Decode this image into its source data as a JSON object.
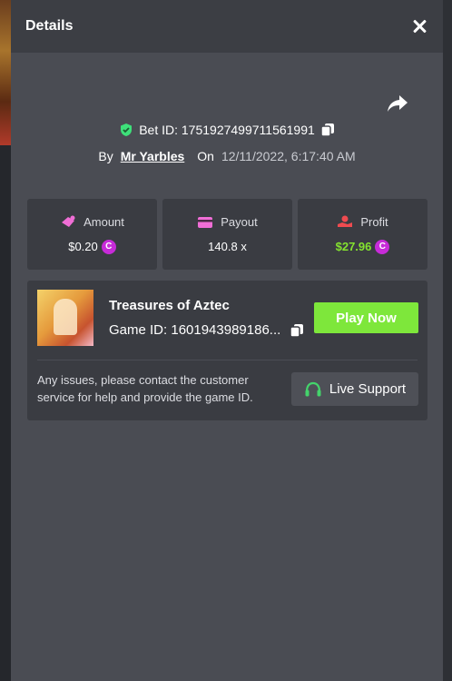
{
  "header": {
    "title": "Details"
  },
  "bet": {
    "label": "Bet ID: 1751927499711561991",
    "by_label": "By",
    "user": "Mr Yarbles",
    "on_label": "On",
    "datetime": "12/11/2022, 6:17:40 AM"
  },
  "stats": {
    "amount": {
      "label": "Amount",
      "value": "$0.20"
    },
    "payout": {
      "label": "Payout",
      "value": "140.8 x"
    },
    "profit": {
      "label": "Profit",
      "value": "$27.96"
    }
  },
  "game": {
    "name": "Treasures of Aztec",
    "id_text": "Game ID: 1601943989186...",
    "play_label": "Play Now",
    "help_text": "Any issues, please contact the customer service for help and provide the game ID.",
    "support_label": "Live Support"
  },
  "colors": {
    "modal_bg": "#4a4c53",
    "header_bg": "#3c3e44",
    "card_bg": "#3a3c42",
    "accent_green": "#7ee73b",
    "profit_green": "#84e32f",
    "coin_purple": "#c72bd8",
    "icon_pink": "#f06ed6",
    "icon_red": "#ef4b50"
  },
  "icons": [
    "close-icon",
    "share-icon",
    "shield-check-icon",
    "copy-icon",
    "amount-icon",
    "payout-card-icon",
    "profit-icon",
    "coin-icon",
    "headset-icon"
  ]
}
